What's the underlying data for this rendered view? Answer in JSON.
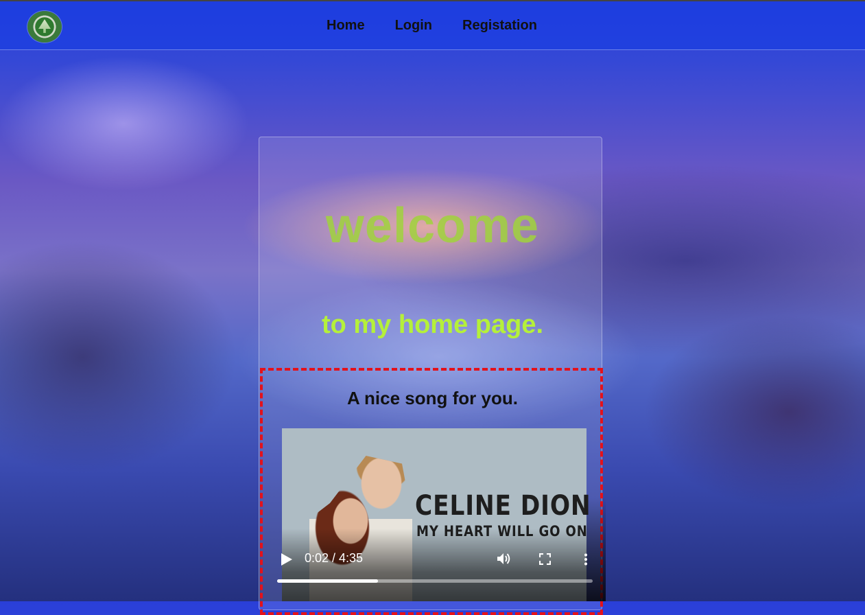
{
  "nav": {
    "items": [
      {
        "label": "Home"
      },
      {
        "label": "Login"
      },
      {
        "label": "Registation"
      }
    ]
  },
  "hero": {
    "title": "welcome",
    "subtitle": "to my home page.",
    "title_color": "#a0d23c",
    "subtitle_color": "#b5f03a"
  },
  "song": {
    "heading": "A nice song for you.",
    "poster": {
      "artist": "CELINE DION",
      "song": "MY HEART WILL GO ON"
    },
    "player": {
      "time": "0:02 / 4:35",
      "progress_fraction": 0.32,
      "icons": [
        "play-icon",
        "volume-icon",
        "fullscreen-icon",
        "more-options-icon"
      ]
    },
    "highlight_color": "#e4121b"
  }
}
